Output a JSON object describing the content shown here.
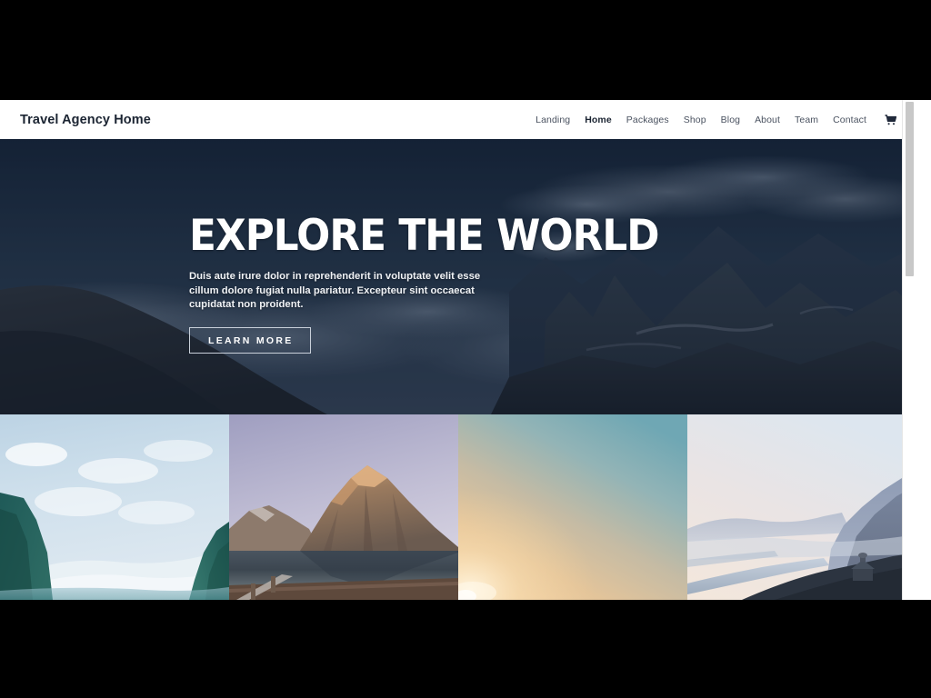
{
  "header": {
    "brand": "Travel Agency Home",
    "nav_items": [
      {
        "label": "Landing",
        "active": false
      },
      {
        "label": "Home",
        "active": true
      },
      {
        "label": "Packages",
        "active": false
      },
      {
        "label": "Shop",
        "active": false
      },
      {
        "label": "Blog",
        "active": false
      },
      {
        "label": "About",
        "active": false
      },
      {
        "label": "Team",
        "active": false
      },
      {
        "label": "Contact",
        "active": false
      }
    ],
    "cart_icon": "shopping-cart-icon"
  },
  "hero": {
    "title": "EXPLORE THE WORLD",
    "subtitle": "Duis aute irure dolor in reprehenderit in voluptate velit esse cillum dolore fugiat nulla pariatur. Excepteur sint occaecat cupidatat non proident.",
    "button_label": "LEARN MORE",
    "background_description": "dark blue mountain range at dusk with clouds"
  },
  "gallery": {
    "items": [
      {
        "name": "turquoise-lake-glacier",
        "alt": "Turquoise glacial lake between steep cliffs"
      },
      {
        "name": "mountain-reflection-lake",
        "alt": "Sunlit rocky mountain reflected in a still lake"
      },
      {
        "name": "sunset-sky-gradient",
        "alt": "Hazy sunset sky gradient with sun glow"
      },
      {
        "name": "river-gorge-vista",
        "alt": "Misty river gorge with a lodge on the ridge"
      }
    ]
  },
  "colors": {
    "hero_bg": "#1b2a3c",
    "brand_text": "#1b2432",
    "nav_text": "#4a5260",
    "nav_active": "#1b2432",
    "button_border": "#c9d0da",
    "page_bg": "#ffffff",
    "chrome_bg": "#000000",
    "scroll_thumb": "#c8c8c8"
  },
  "scrollbar": {
    "name": "vertical-scrollbar",
    "thumb_name": "scrollbar-thumb"
  }
}
